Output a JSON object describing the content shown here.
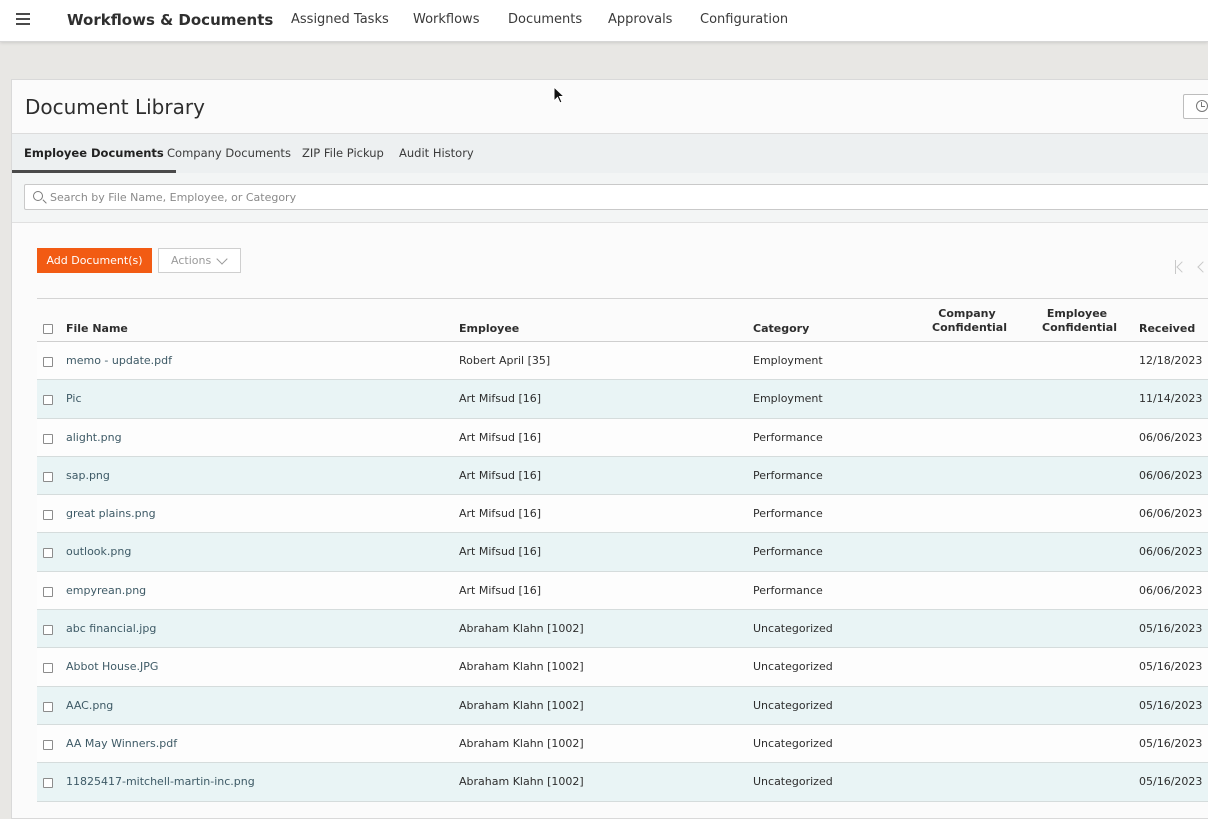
{
  "nav": {
    "app_title": "Workflows & Documents",
    "items": [
      {
        "label": "Assigned Tasks"
      },
      {
        "label": "Workflows"
      },
      {
        "label": "Documents"
      },
      {
        "label": "Approvals"
      },
      {
        "label": "Configuration"
      }
    ]
  },
  "page": {
    "title": "Document Library",
    "tabs": [
      {
        "label": "Employee Documents",
        "active": true
      },
      {
        "label": "Company Documents"
      },
      {
        "label": "ZIP File Pickup"
      },
      {
        "label": "Audit History"
      }
    ],
    "search_placeholder": "Search by File Name, Employee, or Category",
    "add_button": "Add Document(s)",
    "actions_button": "Actions"
  },
  "table": {
    "headers": {
      "file_name": "File Name",
      "employee": "Employee",
      "category": "Category",
      "company_conf_1": "Company",
      "company_conf_2": "Confidential",
      "employee_conf_1": "Employee",
      "employee_conf_2": "Confidential",
      "received": "Received"
    },
    "rows": [
      {
        "file": "memo - update.pdf",
        "employee": "Robert April [35]",
        "category": "Employment",
        "received": "12/18/2023"
      },
      {
        "file": "Pic",
        "employee": "Art Mifsud [16]",
        "category": "Employment",
        "received": "11/14/2023"
      },
      {
        "file": "alight.png",
        "employee": "Art Mifsud [16]",
        "category": "Performance",
        "received": "06/06/2023"
      },
      {
        "file": "sap.png",
        "employee": "Art Mifsud [16]",
        "category": "Performance",
        "received": "06/06/2023"
      },
      {
        "file": "great plains.png",
        "employee": "Art Mifsud [16]",
        "category": "Performance",
        "received": "06/06/2023"
      },
      {
        "file": "outlook.png",
        "employee": "Art Mifsud [16]",
        "category": "Performance",
        "received": "06/06/2023"
      },
      {
        "file": "empyrean.png",
        "employee": "Art Mifsud [16]",
        "category": "Performance",
        "received": "06/06/2023"
      },
      {
        "file": "abc financial.jpg",
        "employee": "Abraham Klahn [1002]",
        "category": "Uncategorized",
        "received": "05/16/2023"
      },
      {
        "file": "Abbot House.JPG",
        "employee": "Abraham Klahn [1002]",
        "category": "Uncategorized",
        "received": "05/16/2023"
      },
      {
        "file": "AAC.png",
        "employee": "Abraham Klahn [1002]",
        "category": "Uncategorized",
        "received": "05/16/2023"
      },
      {
        "file": "AA May Winners.pdf",
        "employee": "Abraham Klahn [1002]",
        "category": "Uncategorized",
        "received": "05/16/2023"
      },
      {
        "file": "11825417-mitchell-martin-inc.png",
        "employee": "Abraham Klahn [1002]",
        "category": "Uncategorized",
        "received": "05/16/2023"
      }
    ]
  },
  "colors": {
    "accent_orange": "#f25b13",
    "row_alt": "#e9f4f5",
    "link_text": "#3e5a66"
  }
}
